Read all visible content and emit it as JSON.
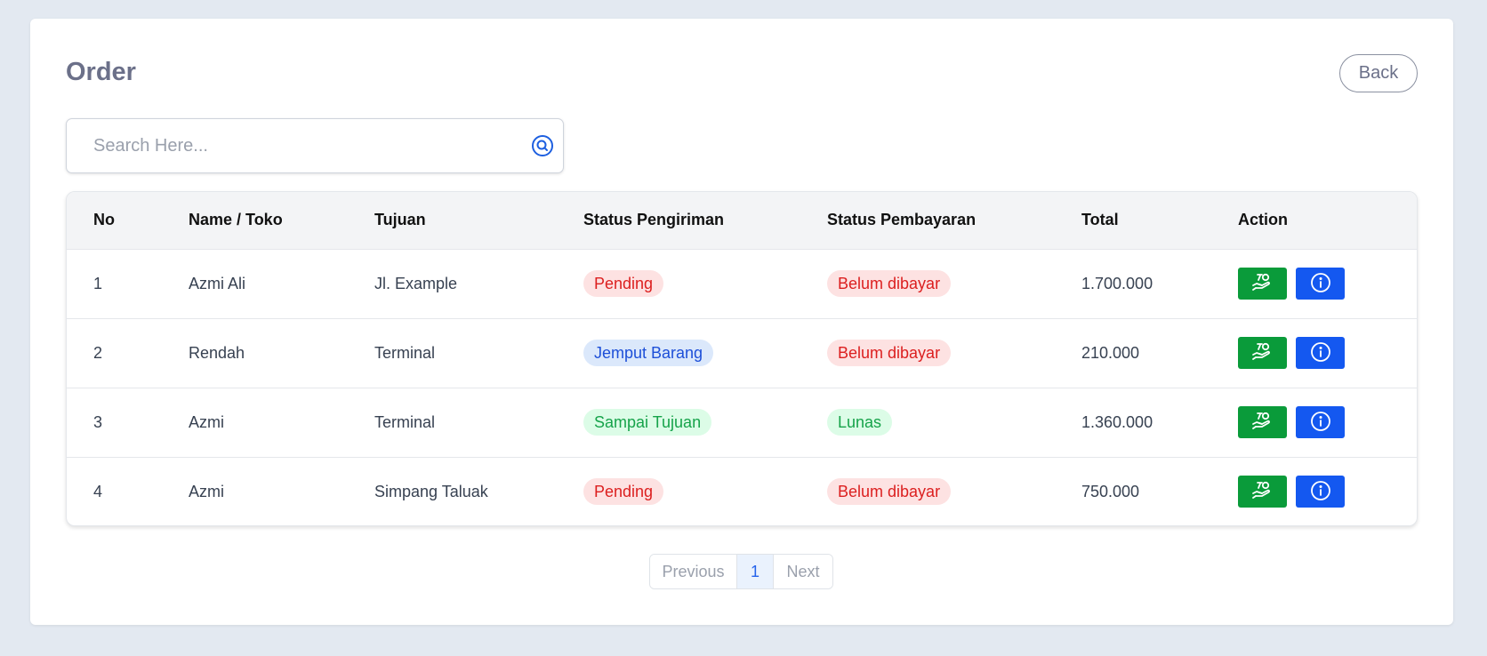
{
  "page": {
    "title": "Order",
    "back_label": "Back"
  },
  "search": {
    "placeholder": "Search Here..."
  },
  "table": {
    "headers": [
      "No",
      "Name / Toko",
      "Tujuan",
      "Status Pengiriman",
      "Status Pembayaran",
      "Total",
      "Action"
    ],
    "rows": [
      {
        "no": "1",
        "name": "Azmi Ali",
        "tujuan": "Jl. Example",
        "pengiriman": "Pending",
        "pembayaran": "Belum dibayar",
        "total": "1.700.000"
      },
      {
        "no": "2",
        "name": "Rendah",
        "tujuan": "Terminal",
        "pengiriman": "Jemput Barang",
        "pembayaran": "Belum dibayar",
        "total": "210.000"
      },
      {
        "no": "3",
        "name": "Azmi",
        "tujuan": "Terminal",
        "pengiriman": "Sampai Tujuan",
        "pembayaran": "Lunas",
        "total": "1.360.000"
      },
      {
        "no": "4",
        "name": "Azmi",
        "tujuan": "Simpang Taluak",
        "pengiriman": "Pending",
        "pembayaran": "Belum dibayar",
        "total": "750.000"
      }
    ]
  },
  "actions": {
    "pay_icon": "hand-money-icon",
    "info_icon": "info-icon"
  },
  "pagination": {
    "previous_label": "Previous",
    "current_page": "1",
    "next_label": "Next"
  },
  "colors": {
    "pending": "#dc1f1f",
    "pickup": "#1d4fd8",
    "arrived": "#16a34a",
    "pay_button": "#0a9b3a",
    "info_button": "#1458f0"
  }
}
